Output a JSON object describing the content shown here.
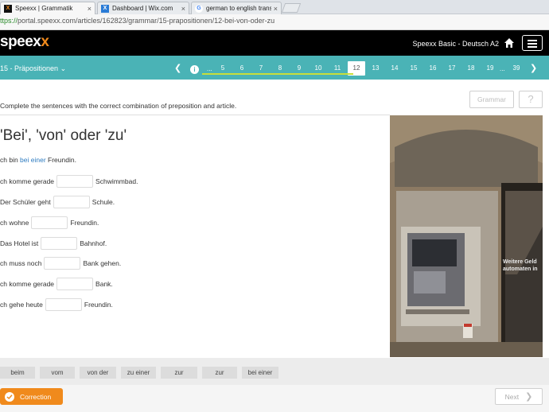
{
  "browser": {
    "tabs": [
      {
        "title": "Speexx | Grammatik",
        "favicon": "speexx-favicon",
        "active": true
      },
      {
        "title": "Dashboard | Wix.com",
        "favicon": "wix-favicon",
        "active": false
      },
      {
        "title": "german to english transla",
        "favicon": "google-favicon",
        "active": false
      }
    ],
    "url_scheme": "ttps://",
    "url_rest": "portal.speexx.com/articles/162823/grammar/15-prapositionen/12-bei-von-oder-zu"
  },
  "header": {
    "logo_main": "speex",
    "logo_x": "x",
    "plan": "Speexx Basic - Deutsch A2"
  },
  "nav": {
    "chapter": "15 - Präpositionen",
    "pages": [
      "5",
      "6",
      "7",
      "8",
      "9",
      "10",
      "11",
      "12",
      "13",
      "14",
      "15",
      "16",
      "17",
      "18",
      "19",
      "39"
    ],
    "current_page": "12",
    "info_label": "i",
    "ellipsis": "..."
  },
  "exercise": {
    "instruction": "Complete the sentences with the correct combination of preposition and article.",
    "grammar_label": "Grammar",
    "help_label": "?",
    "title": "'Bei', 'von' oder 'zu'",
    "example_before": "ch bin ",
    "example_answer": "bei einer",
    "example_after": " Freundin.",
    "sentences": [
      {
        "before": "ch komme gerade",
        "after": "Schwimmbad."
      },
      {
        "before": "Der Schüler geht",
        "after": "Schule."
      },
      {
        "before": "ch wohne",
        "after": "Freundin."
      },
      {
        "before": "Das Hotel ist",
        "after": "Bahnhof."
      },
      {
        "before": "ch muss noch",
        "after": "Bank gehen."
      },
      {
        "before": "ch komme gerade",
        "after": "Bank."
      },
      {
        "before": "ch gehe heute",
        "after": "Freundin."
      }
    ],
    "photo_sign": [
      "Weitere Geld",
      "automaten in"
    ]
  },
  "wordbank": [
    "beim",
    "vom",
    "von der",
    "zu einer",
    "zur",
    "zur",
    "bei einer"
  ],
  "footer": {
    "correction_label": "Correction",
    "next_label": "Next"
  },
  "colors": {
    "teal": "#4ab3b6",
    "orange": "#f08a1c",
    "progress": "#c8de3a",
    "link_blue": "#2d7bc0"
  }
}
